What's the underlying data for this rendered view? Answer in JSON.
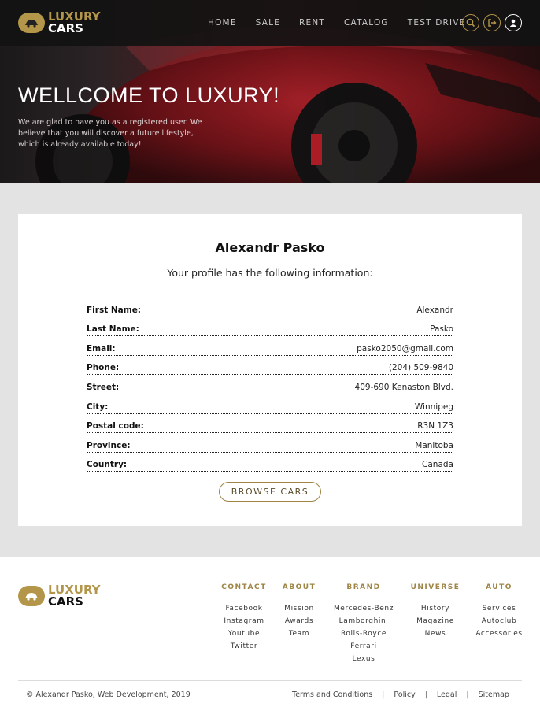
{
  "brand": {
    "line1": "LUXURY",
    "line2": "CARS",
    "accent": "#b3964a"
  },
  "nav": {
    "items": [
      "HOME",
      "SALE",
      "RENT",
      "CATALOG",
      "TEST DRIVE"
    ],
    "icons": [
      "search-icon",
      "sign-out-icon",
      "user-icon"
    ]
  },
  "hero": {
    "title": "WELLCOME TO LUXURY!",
    "subtitle": "We are glad to have you as a registered user. We believe that you will discover a future lifestyle, which is already available today!"
  },
  "profile": {
    "name": "Alexandr Pasko",
    "intro": "Your profile has the following information:",
    "fields": [
      {
        "label": "First Name:",
        "value": "Alexandr"
      },
      {
        "label": "Last Name:",
        "value": "Pasko"
      },
      {
        "label": "Email:",
        "value": "pasko2050@gmail.com"
      },
      {
        "label": "Phone:",
        "value": "(204) 509-9840"
      },
      {
        "label": "Street:",
        "value": "409-690 Kenaston Blvd."
      },
      {
        "label": "City:",
        "value": "Winnipeg"
      },
      {
        "label": "Postal code:",
        "value": "R3N 1Z3"
      },
      {
        "label": "Province:",
        "value": "Manitoba"
      },
      {
        "label": "Country:",
        "value": "Canada"
      }
    ],
    "button": "BROWSE CARS"
  },
  "footer": {
    "columns": [
      {
        "heading": "CONTACT",
        "links": [
          "Facebook",
          "Instagram",
          "Youtube",
          "Twitter"
        ]
      },
      {
        "heading": "ABOUT",
        "links": [
          "Mission",
          "Awards",
          "Team"
        ]
      },
      {
        "heading": "BRAND",
        "links": [
          "Mercedes-Benz",
          "Lamborghini",
          "Rolls-Royce",
          "Ferrari",
          "Lexus"
        ]
      },
      {
        "heading": "UNIVERSE",
        "links": [
          "History",
          "Magazine",
          "News"
        ]
      },
      {
        "heading": "AUTO",
        "links": [
          "Services",
          "Autoclub",
          "Accessories"
        ]
      }
    ],
    "copyright": "© Alexandr Pasko, Web Development, 2019",
    "legal": [
      "Terms and Conditions",
      "Policy",
      "Legal",
      "Sitemap"
    ],
    "separator": "|"
  }
}
